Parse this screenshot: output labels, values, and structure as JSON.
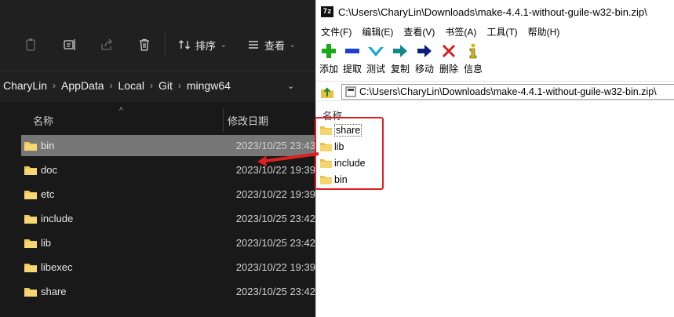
{
  "explorer": {
    "toolbar": {
      "sort_label": "排序",
      "view_label": "查看",
      "more_label": "···"
    },
    "breadcrumb": [
      "CharyLin",
      "AppData",
      "Local",
      "Git",
      "mingw64"
    ],
    "columns": {
      "name": "名称",
      "modified": "修改日期"
    },
    "files": [
      {
        "name": "bin",
        "date": "2023/10/25 23:43",
        "selected": true
      },
      {
        "name": "doc",
        "date": "2023/10/22 19:39"
      },
      {
        "name": "etc",
        "date": "2023/10/22 19:39"
      },
      {
        "name": "include",
        "date": "2023/10/25 23:42"
      },
      {
        "name": "lib",
        "date": "2023/10/25 23:42"
      },
      {
        "name": "libexec",
        "date": "2023/10/22 19:39"
      },
      {
        "name": "share",
        "date": "2023/10/25 23:42"
      }
    ]
  },
  "sevenzip": {
    "logo": "7z",
    "title": "C:\\Users\\CharyLin\\Downloads\\make-4.4.1-without-guile-w32-bin.zip\\",
    "menu": [
      "文件(F)",
      "编辑(E)",
      "查看(V)",
      "书签(A)",
      "工具(T)",
      "帮助(H)"
    ],
    "tools": [
      {
        "label": "添加",
        "icon": "plus-icon",
        "color": "#18a818"
      },
      {
        "label": "提取",
        "icon": "minus-icon",
        "color": "#1a3fd6"
      },
      {
        "label": "测试",
        "icon": "check-icon",
        "color": "#1aa8c8"
      },
      {
        "label": "复制",
        "icon": "copy-arrow-icon",
        "color": "#138a8a"
      },
      {
        "label": "移动",
        "icon": "move-arrow-icon",
        "color": "#0a1f7a"
      },
      {
        "label": "删除",
        "icon": "x-icon",
        "color": "#d81818"
      },
      {
        "label": "信息",
        "icon": "info-icon",
        "color": "#d8b800"
      }
    ],
    "address": "C:\\Users\\CharyLin\\Downloads\\make-4.4.1-without-guile-w32-bin.zip\\",
    "column_name": "名称",
    "items": [
      "share",
      "lib",
      "include",
      "bin"
    ],
    "highlight_color": "#e02020"
  }
}
